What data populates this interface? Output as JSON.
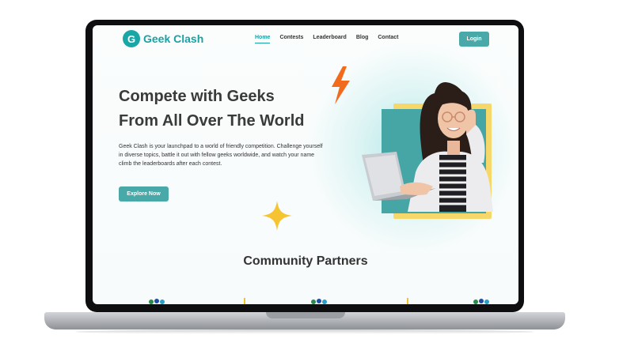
{
  "brand": {
    "name": "Geek Clash",
    "mark": "G",
    "color": "#1aa1a3"
  },
  "nav": {
    "items": [
      {
        "label": "Home",
        "active": true
      },
      {
        "label": "Contests",
        "active": false
      },
      {
        "label": "Leaderboard",
        "active": false
      },
      {
        "label": "Blog",
        "active": false
      },
      {
        "label": "Contact",
        "active": false
      }
    ],
    "login_label": "Login"
  },
  "hero": {
    "title_line1": "Compete with Geeks",
    "title_line2": "From All Over The World",
    "description": "Geek Clash is your launchpad to a world of friendly competition. Challenge yourself in diverse topics, battle it out with fellow geeks worldwide, and watch your name climb the leaderboards after each contest.",
    "cta_label": "Explore Now"
  },
  "partners": {
    "title": "Community Partners"
  },
  "colors": {
    "accent": "#49a8a8",
    "bolt": "#f26b1d",
    "sparkle": "#f7c431",
    "frame": "#f6d86a"
  },
  "icons": {
    "bolt": "lightning-bolt-icon",
    "sparkle": "sparkle-icon"
  }
}
